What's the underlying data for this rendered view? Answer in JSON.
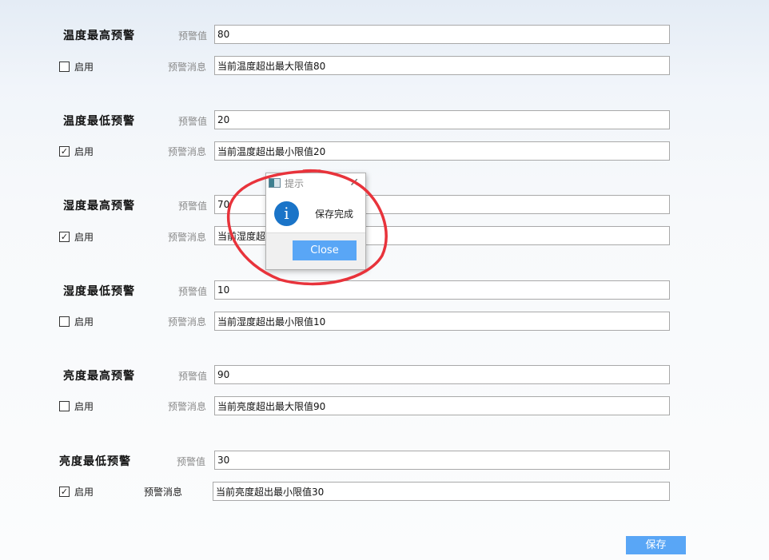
{
  "groups": [
    {
      "title": "温度最高预警",
      "threshold_label": "预警值",
      "threshold_value": "80",
      "enable_label": "启用",
      "enabled": false,
      "message_label": "预警消息",
      "message_value": "当前温度超出最大限值80"
    },
    {
      "title": "温度最低预警",
      "threshold_label": "预警值",
      "threshold_value": "20",
      "enable_label": "启用",
      "enabled": true,
      "message_label": "预警消息",
      "message_value": "当前温度超出最小限值20"
    },
    {
      "title": "湿度最高预警",
      "threshold_label": "预警值",
      "threshold_value": "70",
      "enable_label": "启用",
      "enabled": true,
      "message_label": "预警消息",
      "message_value": "当前湿度超出最大限值70"
    },
    {
      "title": "湿度最低预警",
      "threshold_label": "预警值",
      "threshold_value": "10",
      "enable_label": "启用",
      "enabled": false,
      "message_label": "预警消息",
      "message_value": "当前湿度超出最小限值10"
    },
    {
      "title": "亮度最高预警",
      "threshold_label": "预警值",
      "threshold_value": "90",
      "enable_label": "启用",
      "enabled": false,
      "message_label": "预警消息",
      "message_value": "当前亮度超出最大限值90"
    },
    {
      "title": "亮度最低预警",
      "threshold_label": "预警值",
      "threshold_value": "30",
      "enable_label": "启用",
      "enabled": true,
      "message_label": "预警消息",
      "message_value": "当前亮度超出最小限值30"
    }
  ],
  "save_label": "保存",
  "dialog": {
    "title": "提示",
    "close_glyph": "✕",
    "icon": "info-icon",
    "icon_glyph": "i",
    "message": "保存完成",
    "button_label": "Close"
  },
  "colors": {
    "accent_button": "#59a6f6",
    "annotation": "#e8333b",
    "info_icon": "#1a74c8"
  }
}
